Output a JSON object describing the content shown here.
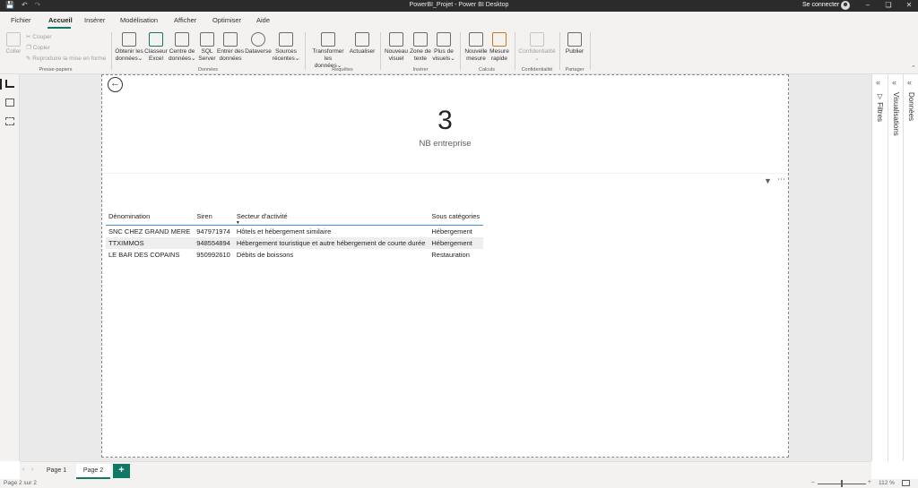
{
  "window": {
    "title": "PowerBI_Projet - Power BI Desktop",
    "signin": "Se connecter",
    "icons": [
      "save-icon",
      "undo-icon",
      "redo-icon"
    ]
  },
  "menu": {
    "items": [
      "Fichier",
      "Accueil",
      "Insérer",
      "Modélisation",
      "Afficher",
      "Optimiser",
      "Aide"
    ],
    "active": "Accueil"
  },
  "ribbon": {
    "clipboard": {
      "paste": "Coller",
      "cut": "Couper",
      "copy": "Copier",
      "format_painter": "Reproduire la mise en forme",
      "group": "Presse-papiers"
    },
    "data": {
      "get_data_l1": "Obtenir les",
      "get_data_l2": "données",
      "excel_l1": "Classeur",
      "excel_l2": "Excel",
      "hub_l1": "Centre de",
      "hub_l2": "données",
      "sql_l1": "SQL",
      "sql_l2": "Server",
      "enter_l1": "Entrer des",
      "enter_l2": "données",
      "dataverse": "Dataverse",
      "recent_l1": "Sources",
      "recent_l2": "récentes",
      "group": "Données"
    },
    "queries": {
      "transform_l1": "Transformer les",
      "transform_l2": "données",
      "refresh": "Actualiser",
      "group": "Requêtes"
    },
    "insert": {
      "new_visual_l1": "Nouveau",
      "new_visual_l2": "visuel",
      "textbox_l1": "Zone de",
      "textbox_l2": "texte",
      "more_l1": "Plus de",
      "more_l2": "visuels",
      "group": "Insérer"
    },
    "calc": {
      "new_measure_l1": "Nouvelle",
      "new_measure_l2": "mesure",
      "quick_l1": "Mesure",
      "quick_l2": "rapide",
      "group": "Calculs"
    },
    "sensitivity": {
      "label": "Confidentialité",
      "group": "Confidentialité"
    },
    "share": {
      "publish": "Publier",
      "group": "Partager"
    }
  },
  "card": {
    "value": "3",
    "label": "NB entreprise"
  },
  "table": {
    "headers": [
      "Dénomination",
      "Siren",
      "Secteur d'activité",
      "Sous catégories"
    ],
    "rows": [
      [
        "SNC CHEZ GRAND MERE",
        "947971974",
        "Hôtels et hébergement similaire",
        "Hébergement"
      ],
      [
        "TTXIMMOS",
        "948554894",
        "Hébergement touristique et autre hébergement de courte durée",
        "Hébergement"
      ],
      [
        "LE BAR DES COPAINS",
        "950992610",
        "Débits de boissons",
        "Restauration"
      ]
    ]
  },
  "panes": {
    "filters": "Filtres",
    "visualizations": "Visualisations",
    "data": "Données"
  },
  "pages": {
    "tabs": [
      "Page 1",
      "Page 2"
    ],
    "active": "Page 2",
    "add": "+"
  },
  "status": {
    "page_indicator": "Page 2 sur 2",
    "zoom": "112 %",
    "zoom_level_percent": 112
  },
  "colors": {
    "accent": "#117865",
    "title_bar": "#2b2b2b",
    "table_underline": "#3a8fd6"
  }
}
